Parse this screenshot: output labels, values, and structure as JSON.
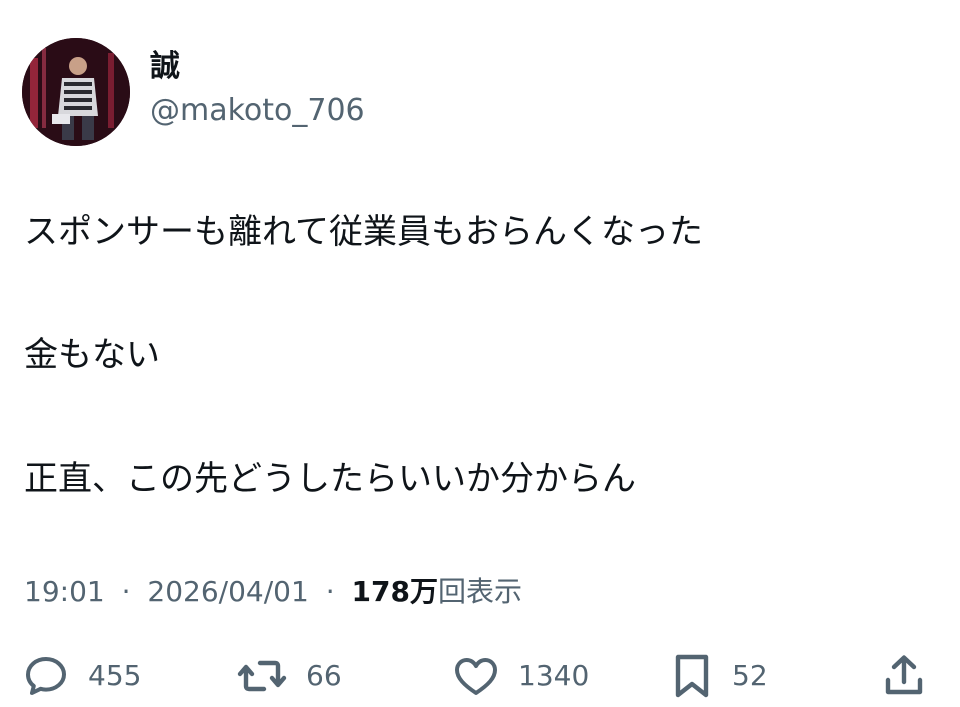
{
  "user": {
    "name": "誠",
    "handle": "@makoto_706",
    "avatar_icon": "profile-photo"
  },
  "tweet": {
    "lines": [
      "スポンサーも離れて従業員もおらんくなった",
      "金もない",
      "正直、この先どうしたらいいか分からん"
    ],
    "time": "19:01",
    "date": "2026/04/01",
    "separator": "·",
    "views_count": "178万",
    "views_label": "回表示"
  },
  "actions": {
    "reply": {
      "icon": "reply-icon",
      "count": "455"
    },
    "retweet": {
      "icon": "retweet-icon",
      "count": "66"
    },
    "like": {
      "icon": "heart-icon",
      "count": "1340"
    },
    "bookmark": {
      "icon": "bookmark-icon",
      "count": "52"
    },
    "share": {
      "icon": "share-icon"
    }
  },
  "colors": {
    "text_primary": "#0f1419",
    "text_secondary": "#536471",
    "background": "#ffffff"
  }
}
